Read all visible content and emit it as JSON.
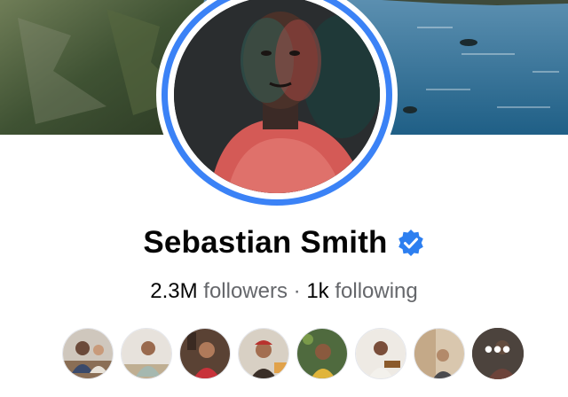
{
  "profile": {
    "name": "Sebastian Smith",
    "verified": true,
    "followers_count": "2.3M",
    "followers_label": "followers",
    "separator": "·",
    "following_count": "1k",
    "following_label": "following"
  },
  "friends_preview": {
    "avatars": [
      {
        "alt": "friend-1"
      },
      {
        "alt": "friend-2"
      },
      {
        "alt": "friend-3"
      },
      {
        "alt": "friend-4"
      },
      {
        "alt": "friend-5"
      },
      {
        "alt": "friend-6"
      },
      {
        "alt": "friend-7"
      }
    ],
    "more_label": "•••"
  },
  "colors": {
    "accent_blue": "#3b82f6",
    "text_primary": "#050505",
    "text_secondary": "#65676b"
  },
  "icons": {
    "verified": "verified-badge-icon",
    "more": "more-dots-icon"
  }
}
